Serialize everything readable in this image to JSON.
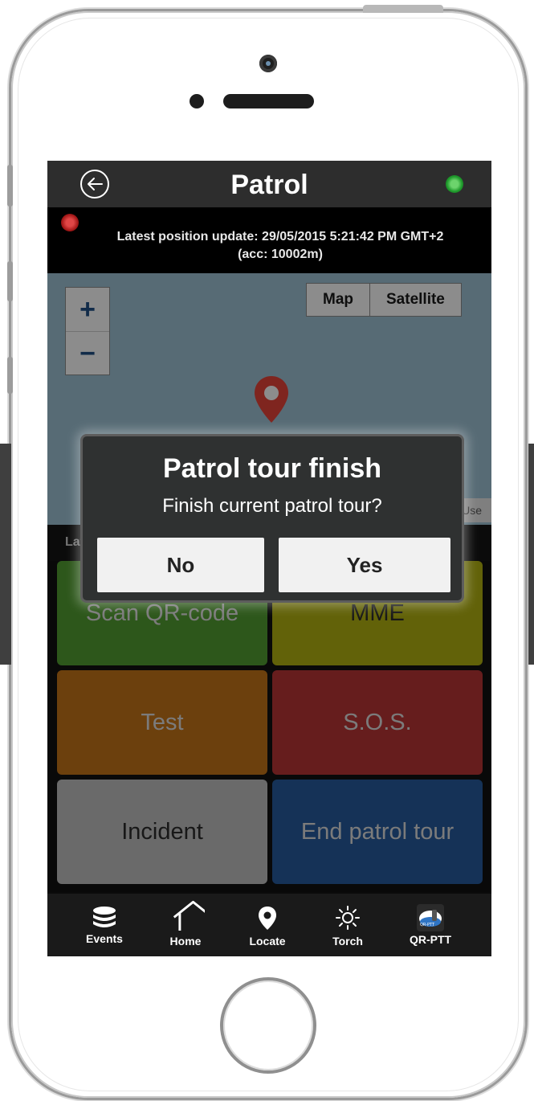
{
  "header": {
    "title": "Patrol"
  },
  "position": {
    "line1": "Latest position update: 29/05/2015 5:21:42 PM GMT+2",
    "line2": "(acc: 10002m)"
  },
  "map": {
    "zoom_in": "+",
    "zoom_out": "−",
    "type_map": "Map",
    "type_satellite": "Satellite",
    "terms": "Terms of Use"
  },
  "later_label": "Lat",
  "tiles": {
    "scan": "Scan QR-code",
    "mme": "MME",
    "test": "Test",
    "sos": "S.O.S.",
    "incident": "Incident",
    "end": "End patrol tour"
  },
  "dialog": {
    "title": "Patrol tour finish",
    "message": "Finish current patrol tour?",
    "no": "No",
    "yes": "Yes"
  },
  "tabbar": {
    "events": "Events",
    "home": "Home",
    "locate": "Locate",
    "torch": "Torch",
    "qrptt": "QR-PTT",
    "qrptt_logo_text": "QR-PTT"
  },
  "colors": {
    "scan": "#5fb63a",
    "mme": "#cccc14",
    "test": "#e2851c",
    "sos": "#d63d3d",
    "incident": "#dcdcdc",
    "end": "#2c6bb4",
    "status_green": "#1f9a2c",
    "status_red": "#a11616"
  },
  "icons": [
    "back-arrow-icon",
    "status-green-icon",
    "status-red-icon",
    "map-pin-icon",
    "events-icon",
    "home-icon",
    "locate-icon",
    "torch-icon",
    "qr-ptt-icon"
  ]
}
